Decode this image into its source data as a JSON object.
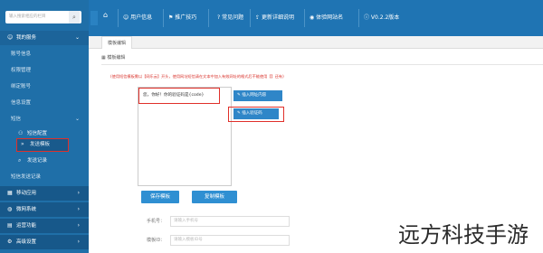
{
  "sidebar": {
    "search_placeholder": "输入搜索相应的栏目",
    "search_icon": "search-icon",
    "items": [
      {
        "label": "我的服务",
        "icon": "user-icon"
      },
      {
        "label": "账号信息"
      },
      {
        "label": "权限管理"
      },
      {
        "label": "绑定账号"
      },
      {
        "label": "信息设置"
      },
      {
        "label": "短信"
      },
      {
        "label": "短信配置",
        "icon": "users-icon"
      },
      {
        "label": "发送模板",
        "icon": "double-chevron-right-icon"
      },
      {
        "label": "发送记录",
        "icon": "search-icon"
      },
      {
        "label": "短信发送记录"
      }
    ],
    "bottom_items": [
      {
        "label": "移动应用",
        "icon": "grid-icon"
      },
      {
        "label": "微网系统",
        "icon": "globe-icon"
      },
      {
        "label": "运营功能",
        "icon": "chart-icon"
      },
      {
        "label": "高级设置",
        "icon": "gear-icon"
      }
    ]
  },
  "topbar": {
    "home_icon": "home-icon",
    "items": [
      {
        "label": "用户信息",
        "icon": "user-icon"
      },
      {
        "label": "推广技巧",
        "icon": "flag-icon"
      },
      {
        "label": "常见问题",
        "icon": "question-icon"
      },
      {
        "label": "更新详细说明",
        "icon": "upload-icon"
      },
      {
        "label": "体验网站名",
        "icon": "eye-icon"
      },
      {
        "label": "V0.2.2版本",
        "icon": "info-icon"
      }
    ]
  },
  "tab_label": "模板编辑",
  "panel_title": "模板编辑",
  "notice": "(使用短信模板需以【网乐云】开头，使用网址短信请在文本中加入有效网址的格式后不能使用【】还有)",
  "editor_text": "您，你好！你的验证码是{code}",
  "side_buttons": [
    "插入网址内容",
    "插入验证码"
  ],
  "buttons": {
    "save": "保存模板",
    "copy": "复制模板"
  },
  "form": [
    {
      "label": "手机号：",
      "placeholder": "请输入手机号"
    },
    {
      "label": "模板ID：",
      "placeholder": "请输入模板ID号"
    }
  ],
  "watermark": "远方科技手游"
}
